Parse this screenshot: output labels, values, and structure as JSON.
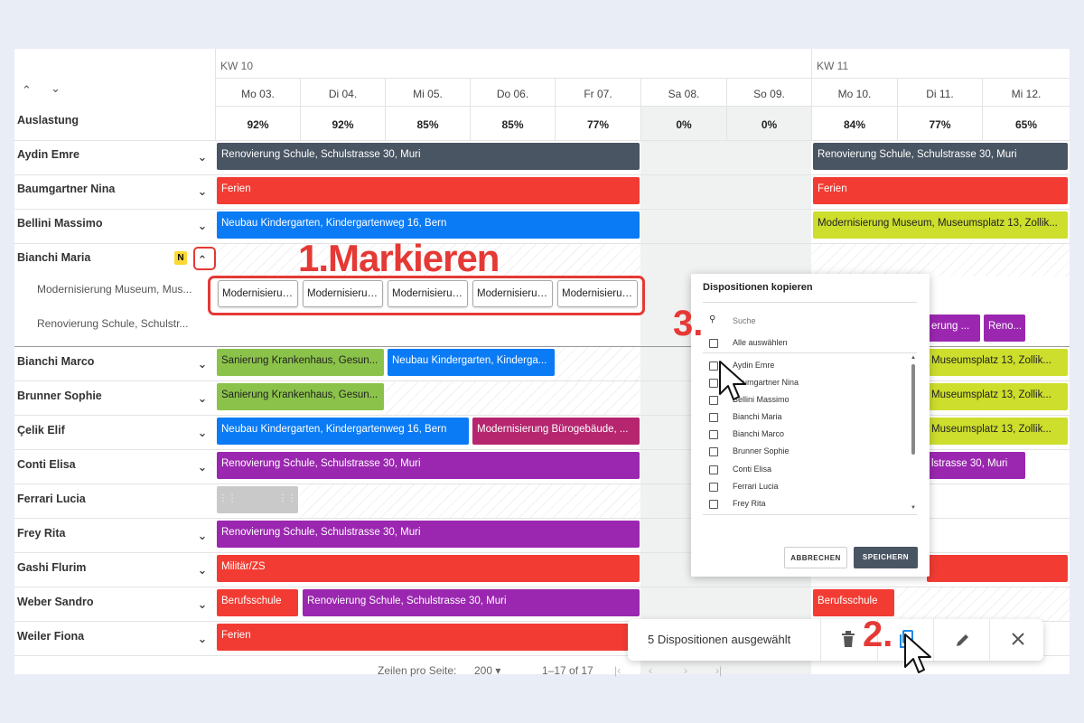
{
  "header": {
    "week1": "KW 10",
    "week2": "KW 11",
    "days": [
      "Mo 03.",
      "Di 04.",
      "Mi 05.",
      "Do 06.",
      "Fr 07.",
      "Sa 08.",
      "So 09.",
      "Mo 10.",
      "Di 11.",
      "Mi 12."
    ],
    "load_label": "Auslastung",
    "load_values": [
      "92%",
      "92%",
      "85%",
      "85%",
      "77%",
      "0%",
      "0%",
      "84%",
      "77%",
      "65%"
    ],
    "sort_up_icon": "chevron-up-icon",
    "sort_down_icon": "chevron-down-icon"
  },
  "rows": {
    "names": [
      "Aydin Emre",
      "Baumgartner Nina",
      "Bellini Massimo",
      "Bianchi Maria",
      "Bianchi Marco",
      "Brunner Sophie",
      "Çelik Elif",
      "Conti Elisa",
      "Ferrari Lucia",
      "Frey Rita",
      "Gashi Flurim",
      "Weber Sandro",
      "Weiler Fiona"
    ],
    "maria_badge": "N",
    "maria_sub1": "Modernisierung Museum, Mus...",
    "maria_sub2": "Renovierung Schule, Schulstr..."
  },
  "bars": {
    "aydin1": "Renovierung Schule, Schulstrasse 30, Muri",
    "aydin2": "Renovierung Schule, Schulstrasse 30, Muri",
    "baum1": "Ferien",
    "baum2": "Ferien",
    "bellini1": "Neubau Kindergarten, Kindergartenweg 16, Bern",
    "bellini2": "Modernisierung Museum, Museumsplatz 13, Zollik...",
    "chip": "Modernisierung...",
    "maria_r1": "erung ...",
    "maria_r2": "Reno...",
    "marco1": "Sanierung Krankenhaus, Gesun...",
    "marco2": "Neubau Kindergarten, Kinderga...",
    "marco3": "Museumsplatz 13, Zollik...",
    "brunner1": "Sanierung Krankenhaus, Gesun...",
    "brunner2": "Museumsplatz 13, Zollik...",
    "celik1": "Neubau Kindergarten, Kindergartenweg 16, Bern",
    "celik2": "Modernisierung Bürogebäude, ...",
    "celik3": "Museumsplatz 13, Zollik...",
    "conti1": "Renovierung Schule, Schulstrasse 30, Muri",
    "conti2": "lstrasse 30, Muri",
    "frey1": "Renovierung Schule, Schulstrasse 30, Muri",
    "gashi1": "Militär/ZS",
    "weber1": "Berufsschule",
    "weber2": "Renovierung Schule, Schulstrasse 30, Muri",
    "weber3": "Berufsschule",
    "weiler1": "Ferien"
  },
  "annotations": {
    "step1": "1.Markieren",
    "step2": "2.",
    "step3": "3."
  },
  "dialog": {
    "title": "Dispositionen kopieren",
    "search_placeholder": "Suche",
    "select_all": "Alle auswählen",
    "items": [
      "Aydin Emre",
      "Baumgartner Nina",
      "Bellini Massimo",
      "Bianchi Maria",
      "Bianchi Marco",
      "Brunner Sophie",
      "Conti Elisa",
      "Ferrari Lucia",
      "Frey Rita"
    ],
    "cancel": "ABBRECHEN",
    "save": "SPEICHERN"
  },
  "toolbar": {
    "selection_text": "5 Dispositionen ausgewählt"
  },
  "pager": {
    "rows_label": "Zeilen pro Seite:",
    "rows_value": "200",
    "range": "1–17 of 17"
  },
  "colors": {
    "dark": "#4a5563",
    "red": "#f23c33",
    "blue": "#0a7bf5",
    "lime": "#cdde2c",
    "green": "#8bc34a",
    "purple": "#9b27b0",
    "magenta": "#b5266f",
    "grey": "#c9c9c9",
    "annotation_red": "#e53935"
  }
}
